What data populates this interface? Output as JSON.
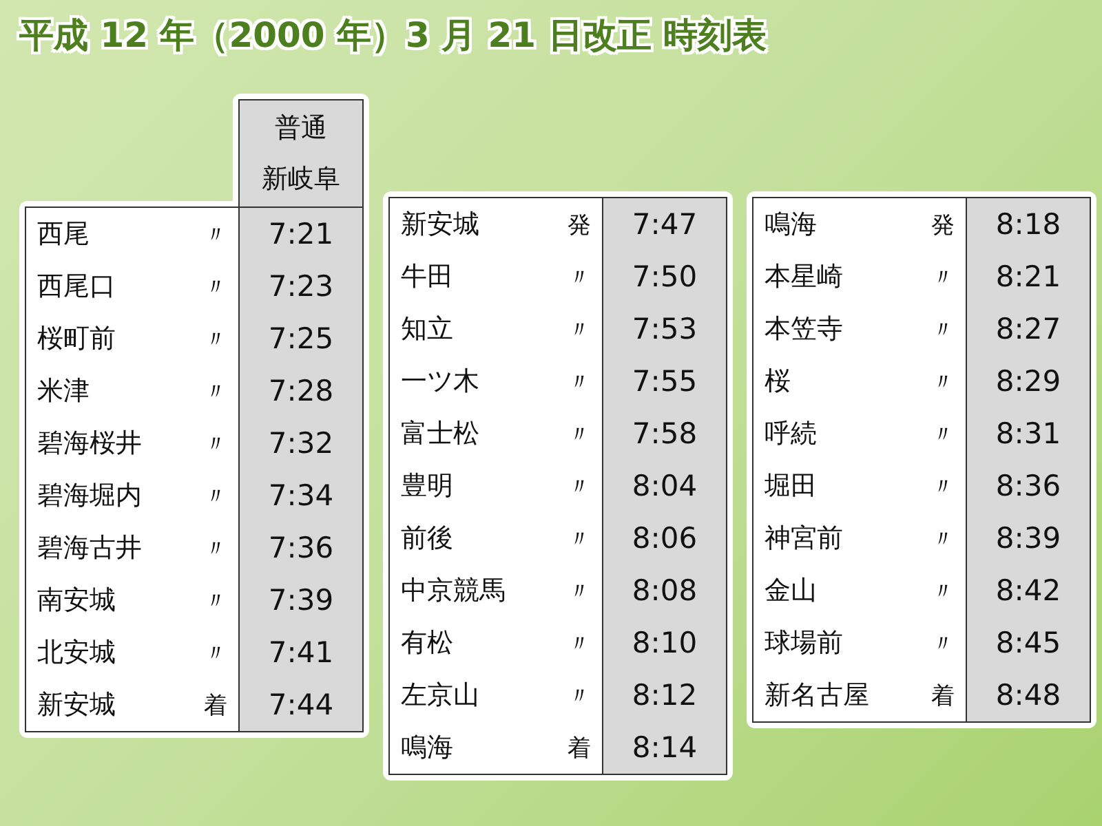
{
  "title": "平成 12 年（2000 年）3 月 21 日改正 時刻表",
  "timetables": [
    {
      "header": {
        "train_type": "普通",
        "destination": "新岐阜"
      },
      "rows": [
        {
          "station": "西尾",
          "mark": "〃",
          "time": "7:21"
        },
        {
          "station": "西尾口",
          "mark": "〃",
          "time": "7:23"
        },
        {
          "station": "桜町前",
          "mark": "〃",
          "time": "7:25"
        },
        {
          "station": "米津",
          "mark": "〃",
          "time": "7:28"
        },
        {
          "station": "碧海桜井",
          "mark": "〃",
          "time": "7:32"
        },
        {
          "station": "碧海堀内",
          "mark": "〃",
          "time": "7:34"
        },
        {
          "station": "碧海古井",
          "mark": "〃",
          "time": "7:36"
        },
        {
          "station": "南安城",
          "mark": "〃",
          "time": "7:39"
        },
        {
          "station": "北安城",
          "mark": "〃",
          "time": "7:41"
        },
        {
          "station": "新安城",
          "mark": "着",
          "time": "7:44"
        }
      ]
    },
    {
      "rows": [
        {
          "station": "新安城",
          "mark": "発",
          "time": "7:47"
        },
        {
          "station": "牛田",
          "mark": "〃",
          "time": "7:50"
        },
        {
          "station": "知立",
          "mark": "〃",
          "time": "7:53"
        },
        {
          "station": "一ツ木",
          "mark": "〃",
          "time": "7:55"
        },
        {
          "station": "富士松",
          "mark": "〃",
          "time": "7:58"
        },
        {
          "station": "豊明",
          "mark": "〃",
          "time": "8:04"
        },
        {
          "station": "前後",
          "mark": "〃",
          "time": "8:06"
        },
        {
          "station": "中京競馬",
          "mark": "〃",
          "time": "8:08"
        },
        {
          "station": "有松",
          "mark": "〃",
          "time": "8:10"
        },
        {
          "station": "左京山",
          "mark": "〃",
          "time": "8:12"
        },
        {
          "station": "鳴海",
          "mark": "着",
          "time": "8:14"
        }
      ]
    },
    {
      "rows": [
        {
          "station": "鳴海",
          "mark": "発",
          "time": "8:18"
        },
        {
          "station": "本星崎",
          "mark": "〃",
          "time": "8:21"
        },
        {
          "station": "本笠寺",
          "mark": "〃",
          "time": "8:27"
        },
        {
          "station": "桜",
          "mark": "〃",
          "time": "8:29"
        },
        {
          "station": "呼続",
          "mark": "〃",
          "time": "8:31"
        },
        {
          "station": "堀田",
          "mark": "〃",
          "time": "8:36"
        },
        {
          "station": "神宮前",
          "mark": "〃",
          "time": "8:39"
        },
        {
          "station": "金山",
          "mark": "〃",
          "time": "8:42"
        },
        {
          "station": "球場前",
          "mark": "〃",
          "time": "8:45"
        },
        {
          "station": "新名古屋",
          "mark": "着",
          "time": "8:48"
        }
      ]
    }
  ]
}
